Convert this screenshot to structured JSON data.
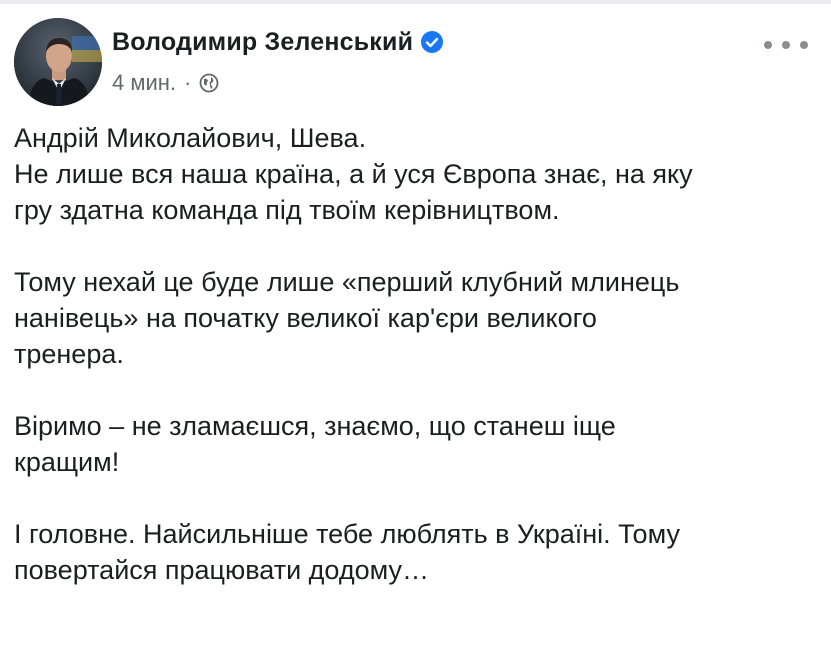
{
  "post": {
    "author": "Володимир Зеленський",
    "time": "4 мин.",
    "separator": "·",
    "icons": {
      "verified": "verified-badge-icon",
      "audience": "globe-icon",
      "more": "more-options-icon"
    },
    "colors": {
      "verified": "#1877f2",
      "meta": "#65676b",
      "text": "#1c1e21"
    },
    "paragraphs": [
      "Андрій Миколайович, Шева.\nНе лише вся наша країна, а й уся Європа знає, на яку\nгру здатна команда під твоїм керівництвом.",
      "Тому нехай це буде лише «перший клубний млинець\nнанівець» на початку великої кар'єри великого\nтренера.",
      "Віримо – не зламаєшся, знаємо, що станеш іще\nкращим!",
      "І головне. Найсильніше тебе люблять в Україні. Тому\nповертайся працювати додому…"
    ]
  }
}
